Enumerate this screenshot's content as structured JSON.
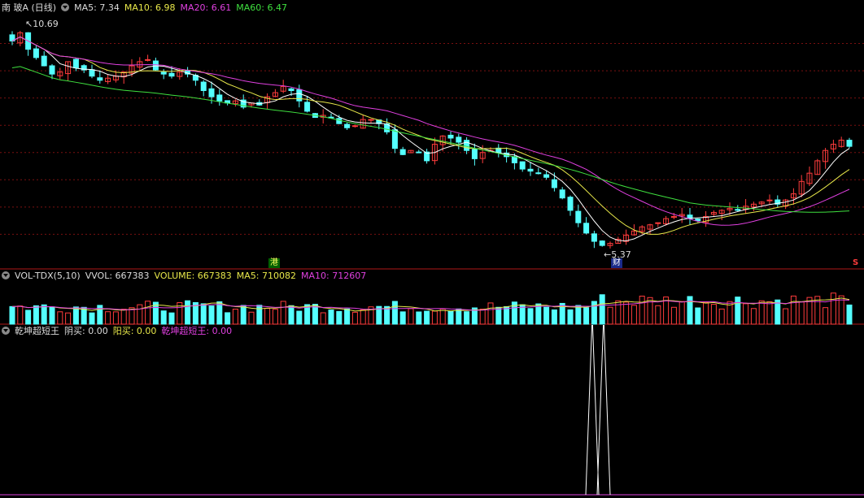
{
  "price_header": {
    "title": "南 玻A (日线)",
    "ma5": "MA5: 7.34",
    "ma10": "MA10: 6.98",
    "ma20": "MA20: 6.61",
    "ma60": "MA60: 6.47"
  },
  "price_annotations": {
    "high_label": "10.69",
    "low_label": "5.37",
    "marker_hk": "港",
    "marker_cai": "财",
    "marker_s": "S"
  },
  "volume_header": {
    "title": "VOL-TDX(5,10)",
    "vvol": "VVOL: 667383",
    "volume": "VOLUME: 667383",
    "ma5": "MA5: 710082",
    "ma10": "MA10: 712607"
  },
  "indicator_header": {
    "title": "乾坤超短王",
    "yin_buy": "阴买: 0.00",
    "yang_buy": "阳买: 0.00",
    "qk": "乾坤超短王: 0.00"
  },
  "colors": {
    "up": "#ff3c3c",
    "down": "#54ffff",
    "ma5": "#ffffff",
    "ma10": "#e8e84a",
    "ma20": "#e040e0",
    "ma60": "#3fe03f",
    "grid": "#7a1010"
  },
  "chart_data": {
    "type": "candlestick",
    "price_ylim": [
      5.0,
      11.0
    ],
    "closes": [
      10.4,
      10.6,
      10.2,
      10.0,
      9.8,
      9.6,
      9.65,
      9.9,
      9.75,
      9.7,
      9.55,
      9.45,
      9.5,
      9.55,
      9.65,
      9.8,
      9.9,
      9.95,
      9.7,
      9.6,
      9.55,
      9.65,
      9.6,
      9.45,
      9.2,
      9.05,
      8.95,
      8.9,
      8.95,
      8.8,
      8.9,
      8.85,
      9.05,
      9.15,
      9.3,
      9.2,
      8.95,
      8.7,
      8.55,
      8.6,
      8.55,
      8.4,
      8.3,
      8.35,
      8.5,
      8.5,
      8.4,
      8.2,
      7.8,
      7.65,
      7.75,
      7.7,
      7.5,
      7.9,
      8.1,
      8.05,
      7.95,
      7.75,
      7.55,
      7.7,
      7.75,
      7.7,
      7.6,
      7.45,
      7.3,
      7.25,
      7.2,
      7.1,
      6.85,
      6.6,
      6.3,
      6.0,
      5.75,
      5.55,
      5.45,
      5.5,
      5.6,
      5.7,
      5.8,
      5.9,
      5.95,
      6.0,
      6.1,
      6.15,
      6.2,
      6.1,
      6.05,
      6.15,
      6.25,
      6.3,
      6.35,
      6.3,
      6.4,
      6.45,
      6.5,
      6.55,
      6.45,
      6.55,
      6.7,
      7.0,
      7.2,
      7.5,
      7.75,
      7.9,
      8.0,
      7.85
    ],
    "volume_ylim": [
      0,
      1500000
    ],
    "volume_ma5": 710082,
    "volume_ma10": 712607,
    "volume_last": 667383,
    "indicator_spikes": [
      123,
      126
    ],
    "indicator_values": [
      0.0,
      0.0,
      0.0
    ]
  }
}
